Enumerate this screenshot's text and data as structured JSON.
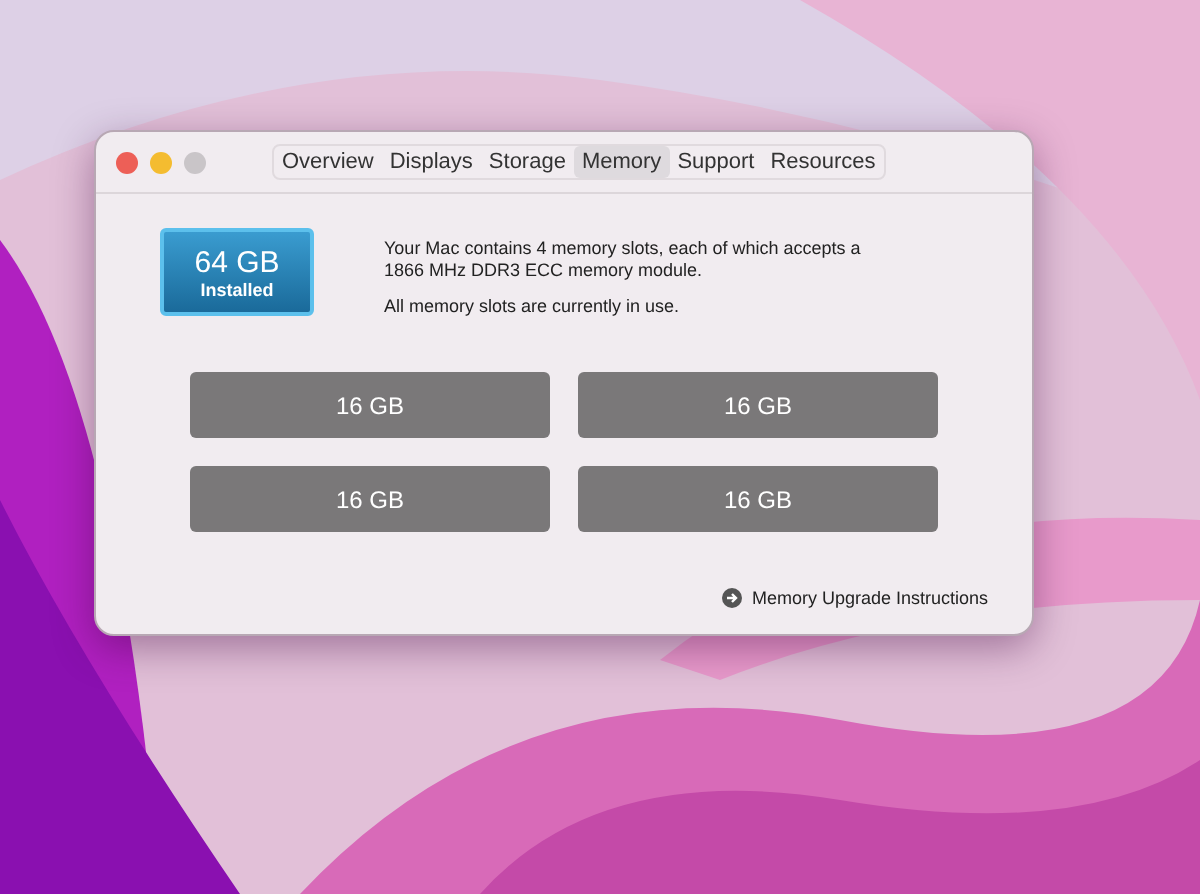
{
  "window": {
    "title_tabs": [
      {
        "label": "Overview",
        "selected": false
      },
      {
        "label": "Displays",
        "selected": false
      },
      {
        "label": "Storage",
        "selected": false
      },
      {
        "label": "Memory",
        "selected": true
      },
      {
        "label": "Support",
        "selected": false
      },
      {
        "label": "Resources",
        "selected": false
      }
    ]
  },
  "memory": {
    "total": "64 GB",
    "caption": "Installed",
    "description": "Your Mac contains 4 memory slots, each of which accepts a 1866 MHz DDR3 ECC memory module.",
    "status": "All memory slots are currently in use."
  },
  "slots": [
    "16 GB",
    "16 GB",
    "16 GB",
    "16 GB"
  ],
  "link": "Memory Upgrade Instructions"
}
